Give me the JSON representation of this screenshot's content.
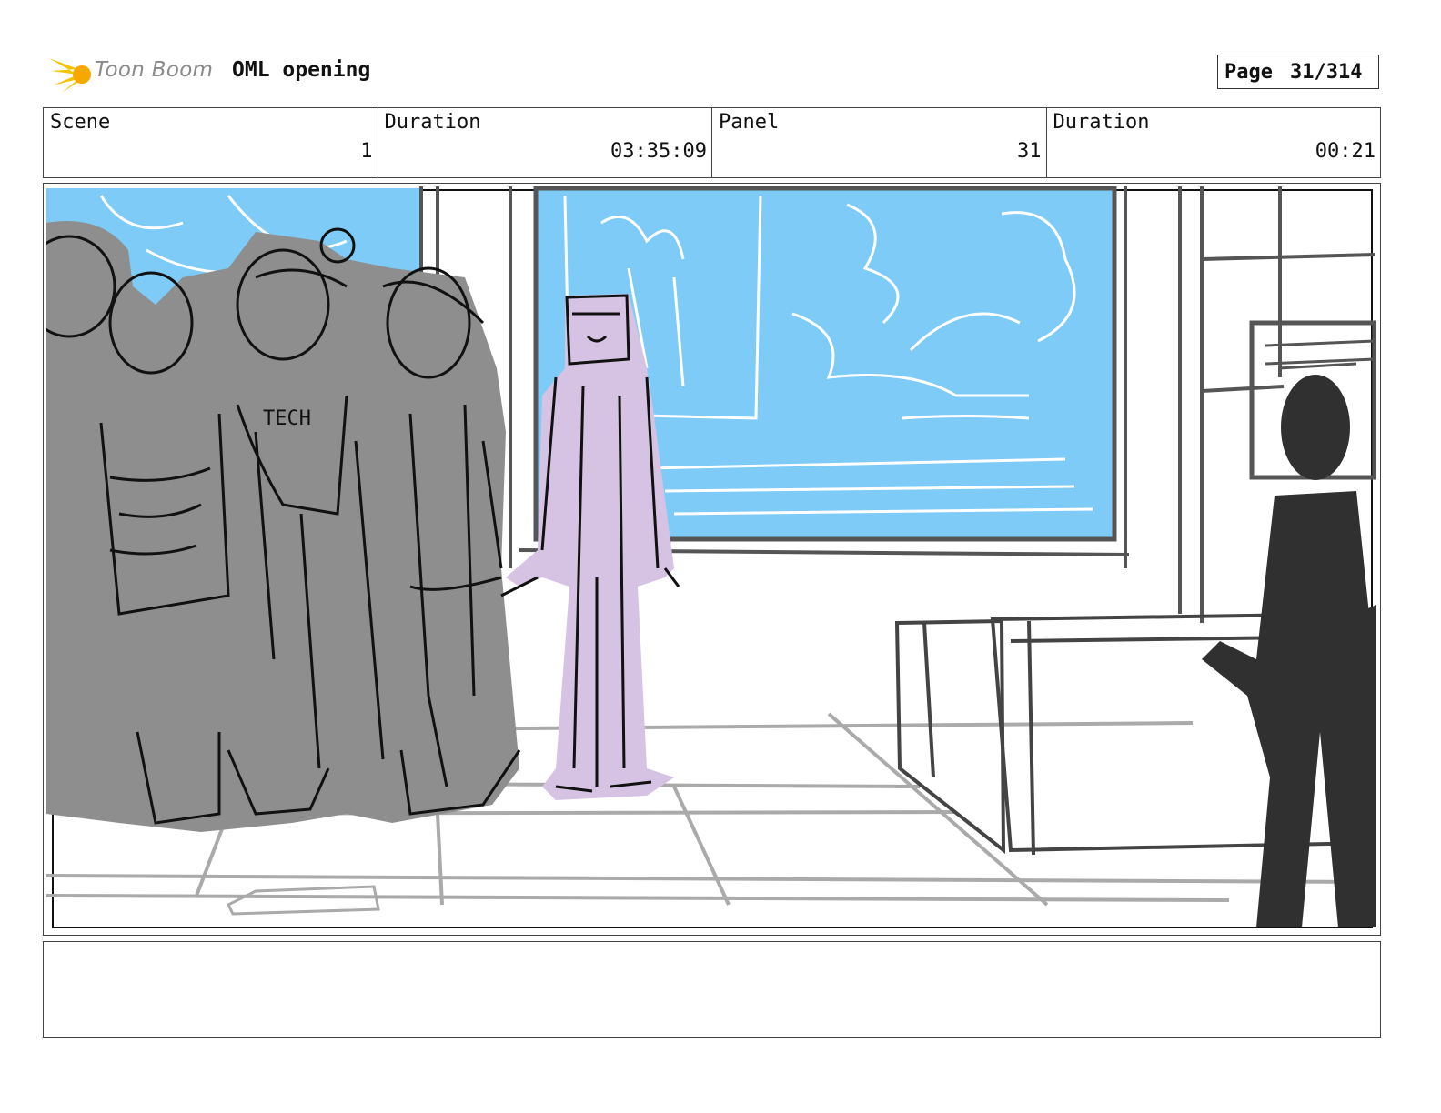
{
  "header": {
    "brand": "Toon Boom",
    "project_title": "OML opening",
    "page_label": "Page",
    "page_value": "31/314"
  },
  "info": {
    "scene_label": "Scene",
    "scene_value": "1",
    "duration_label": "Duration",
    "duration_value": "03:35:09",
    "panel_label": "Panel",
    "panel_value": "31",
    "panel_duration_label": "Duration",
    "panel_duration_value": "00:21"
  },
  "panel": {
    "sketch_text": "TECH"
  },
  "notes": {
    "text": ""
  },
  "colors": {
    "window_sky": "#7ecbf7",
    "crowd_fill": "#8e8e8e",
    "character_fill": "#d6c3e3",
    "silhouette_fill": "#303030",
    "logo_yellow": "#f5c400"
  }
}
